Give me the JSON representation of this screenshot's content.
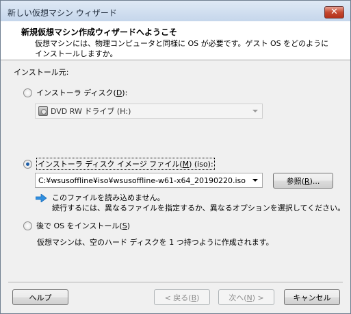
{
  "window": {
    "title": "新しい仮想マシン ウィザード",
    "close_label": "✕"
  },
  "header": {
    "title": "新規仮想マシン作成ウィザードへようこそ",
    "description": "仮想マシンには、物理コンピュータと同様に OS が必要です。ゲスト OS をどのようにインストールしますか。"
  },
  "install_source": {
    "label": "インストール元:",
    "options": [
      {
        "label_prefix": "インストーラ ディスク(",
        "accel": "D",
        "label_suffix": "):",
        "selected": false
      },
      {
        "label_prefix": "インストーラ ディスク イメージ ファイル(",
        "accel": "M",
        "label_suffix": ") (iso):",
        "selected": true
      },
      {
        "label_prefix": "後で OS をインストール(",
        "accel": "S",
        "label_suffix": ")",
        "selected": false
      }
    ],
    "disc_drive": {
      "value": "DVD RW ドライブ (H:)",
      "icon": "dvd-drive-icon"
    },
    "iso_path": {
      "value": "C:¥wsusoffline¥iso¥wsusoffline-w61-x64_20190220.iso"
    },
    "browse_button": {
      "label_prefix": "参照(",
      "accel": "R",
      "label_suffix": ")..."
    },
    "info": {
      "icon": "blue-arrow-icon",
      "line1": "このファイルを読み込めません。",
      "line2": "続行するには、異なるファイルを指定するか、異なるオプションを選択してください。"
    },
    "later_description": "仮想マシンは、空のハード ディスクを 1 つ持つように作成されます。"
  },
  "footer": {
    "help": "ヘルプ",
    "back": {
      "label_prefix": "< 戻る(",
      "accel": "B",
      "label_suffix": ")"
    },
    "next": {
      "label_prefix": "次へ(",
      "accel": "N",
      "label_suffix": ") >"
    },
    "cancel": "キャンセル"
  },
  "colors": {
    "titlebar": "#c5d6eb",
    "close_button": "#c4482f",
    "radio_selected": "#1f5fa8",
    "info_arrow": "#2f8fe0"
  }
}
